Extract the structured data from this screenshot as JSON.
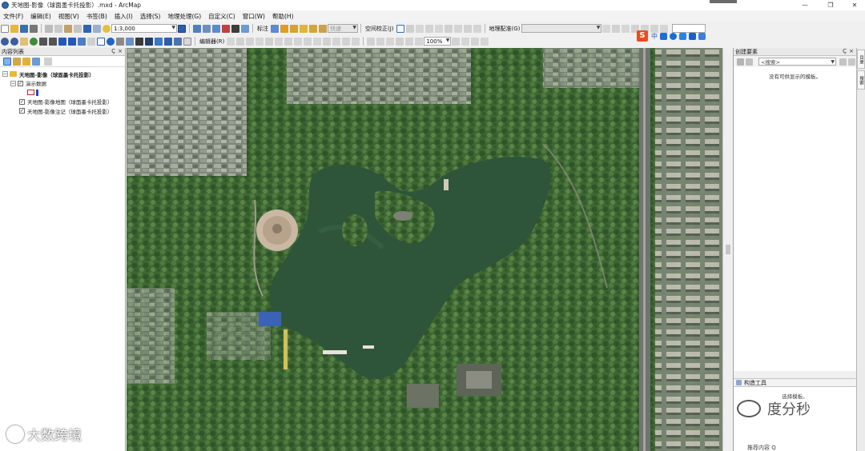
{
  "window": {
    "title": "天地图-影像（球面墨卡托投影）.mxd - ArcMap",
    "controls": [
      "—",
      "❐",
      "✕"
    ]
  },
  "menu": [
    "文件(F)",
    "编辑(E)",
    "视图(V)",
    "书签(B)",
    "插入(I)",
    "选择(S)",
    "地理处理(G)",
    "自定义(C)",
    "窗口(W)",
    "帮助(H)"
  ],
  "toolbar": {
    "scale_value": "1:3,000",
    "label_menu": "标注",
    "quick_combo": "快速",
    "spatial_adjust_menu": "空间校正(J)",
    "georef_menu": "地理配准(G)",
    "editor_menu": "编辑器(R)",
    "zoom_value": "100%",
    "ime_logo": "S",
    "ime_lang": "中"
  },
  "colors": {
    "brand_ime": "#e94d1f",
    "water": "#2f5a3a",
    "vegetation": "#3e6a34",
    "selected_layer_outline": "#d21f1f"
  },
  "toc": {
    "title": "内容列表",
    "pin": "Ҫ",
    "close": "×",
    "layers": {
      "root": "天地图-影像（球面墨卡托投影）",
      "group": "演示数据",
      "imagery_basemap": "天地图-影像地图（球面墨卡托投影）",
      "imagery_annotation": "天地图-影像注记（球面墨卡托投影）"
    }
  },
  "create_features": {
    "title": "创建要素",
    "search_placeholder": "<搜索>",
    "empty_message": "没有可供显示的模板。"
  },
  "construction_tools": {
    "title": "构造工具",
    "hint": "选择模板。"
  },
  "sidetabs": [
    "目录",
    "搜索"
  ],
  "watermarks": {
    "left_text": "大数跨境",
    "right_text": "度分秒",
    "ad_text": "推荐内容 Q"
  }
}
